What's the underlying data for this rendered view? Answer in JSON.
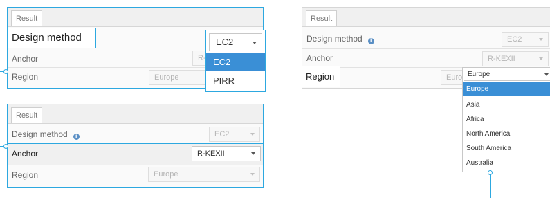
{
  "tab_label": "Result",
  "design_method_label": "Design method",
  "anchor_label": "Anchor",
  "region_label": "Region",
  "design_method_value": "EC2",
  "anchor_value": "R-KEXII",
  "anchor_value_partial": "R-",
  "region_value": "Europe",
  "region_value_partial": "Euro",
  "design_method_options": [
    "EC2",
    "PIRR"
  ],
  "region_options": [
    "Europe",
    "Asia",
    "Africa",
    "North America",
    "South America",
    "Australia"
  ],
  "info_icon_glyph": "i",
  "colors": {
    "highlight": "#2da8e0",
    "selected_option": "#3a8fd6"
  }
}
